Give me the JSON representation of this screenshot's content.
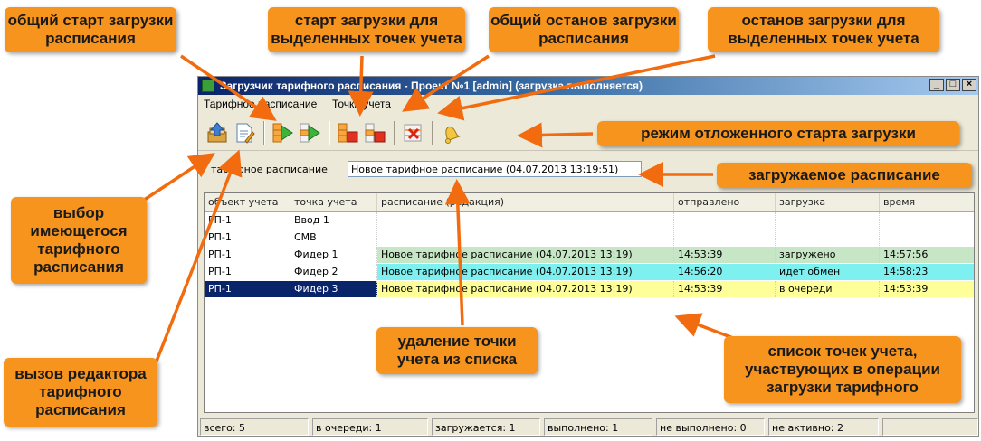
{
  "window": {
    "title": "Загрузчик тарифного расписания - Проект №1 [admin] (загрузка выполняется)",
    "controls": {
      "minimize": "_",
      "maximize": "□",
      "close": "×"
    }
  },
  "menu": {
    "items": [
      "Тарифное расписание",
      "Точки учета"
    ]
  },
  "toolbar": {
    "buttons": [
      {
        "icon": "open-schedule-icon"
      },
      {
        "icon": "edit-schedule-icon"
      },
      {
        "icon": "start-all-icon"
      },
      {
        "icon": "start-selected-icon"
      },
      {
        "icon": "stop-all-icon"
      },
      {
        "icon": "stop-selected-icon"
      },
      {
        "icon": "delete-point-icon"
      },
      {
        "icon": "bell-icon"
      }
    ]
  },
  "schedule": {
    "label": "тарифное расписание",
    "value": "Новое тарифное расписание (04.07.2013 13:19:51)"
  },
  "table": {
    "columns": [
      "объект учета",
      "точка учета",
      "расписание (редакция)",
      "отправлено",
      "загрузка",
      "время"
    ],
    "rows": [
      {
        "object": "РП-1",
        "point": "Ввод 1",
        "schedule": "",
        "sent": "",
        "status": "",
        "time": "",
        "color": "#ffffff"
      },
      {
        "object": "РП-1",
        "point": "СМВ",
        "schedule": "",
        "sent": "",
        "status": "",
        "time": "",
        "color": "#ffffff"
      },
      {
        "object": "РП-1",
        "point": "Фидер 1",
        "schedule": "Новое тарифное расписание  (04.07.2013 13:19)",
        "sent": "14:53:39",
        "status": "загружено",
        "time": "14:57:56",
        "color": "#c6e6c6"
      },
      {
        "object": "РП-1",
        "point": "Фидер 2",
        "schedule": "Новое тарифное расписание  (04.07.2013 13:19)",
        "sent": "14:56:20",
        "status": "идет обмен",
        "time": "14:58:23",
        "color": "#7ff0f0"
      },
      {
        "object": "РП-1",
        "point": "Фидер 3",
        "schedule": "Новое тарифное расписание  (04.07.2013 13:19)",
        "sent": "14:53:39",
        "status": "в очереди",
        "time": "14:53:39",
        "color": "#ffff99",
        "selected": true
      }
    ]
  },
  "status": {
    "total": "всего: 5",
    "queued": "в очереди: 1",
    "loading": "загружается: 1",
    "done": "выполнено: 1",
    "failed": "не выполнено: 0",
    "inactive": "не активно: 2"
  },
  "callouts": {
    "start_all": "общий старт загрузки расписания",
    "start_selected": "старт загрузки для выделенных точек учета",
    "stop_all": "общий останов загрузки расписания",
    "stop_selected": "останов загрузки для выделенных точек учета",
    "deferred": "режим отложенного старта загрузки",
    "loaded_schedule": "загружаемое расписание",
    "choose_schedule": "выбор имеющегося тарифного расписания",
    "editor": "вызов редактора тарифного расписания",
    "delete_point": "удаление точки учета из списка",
    "point_list": "список точек учета, участвующих в операции загрузки тарифного"
  },
  "colors": {
    "accent": "#f7941d",
    "title_blue": "#0a246a",
    "selection": "#0a246a"
  }
}
